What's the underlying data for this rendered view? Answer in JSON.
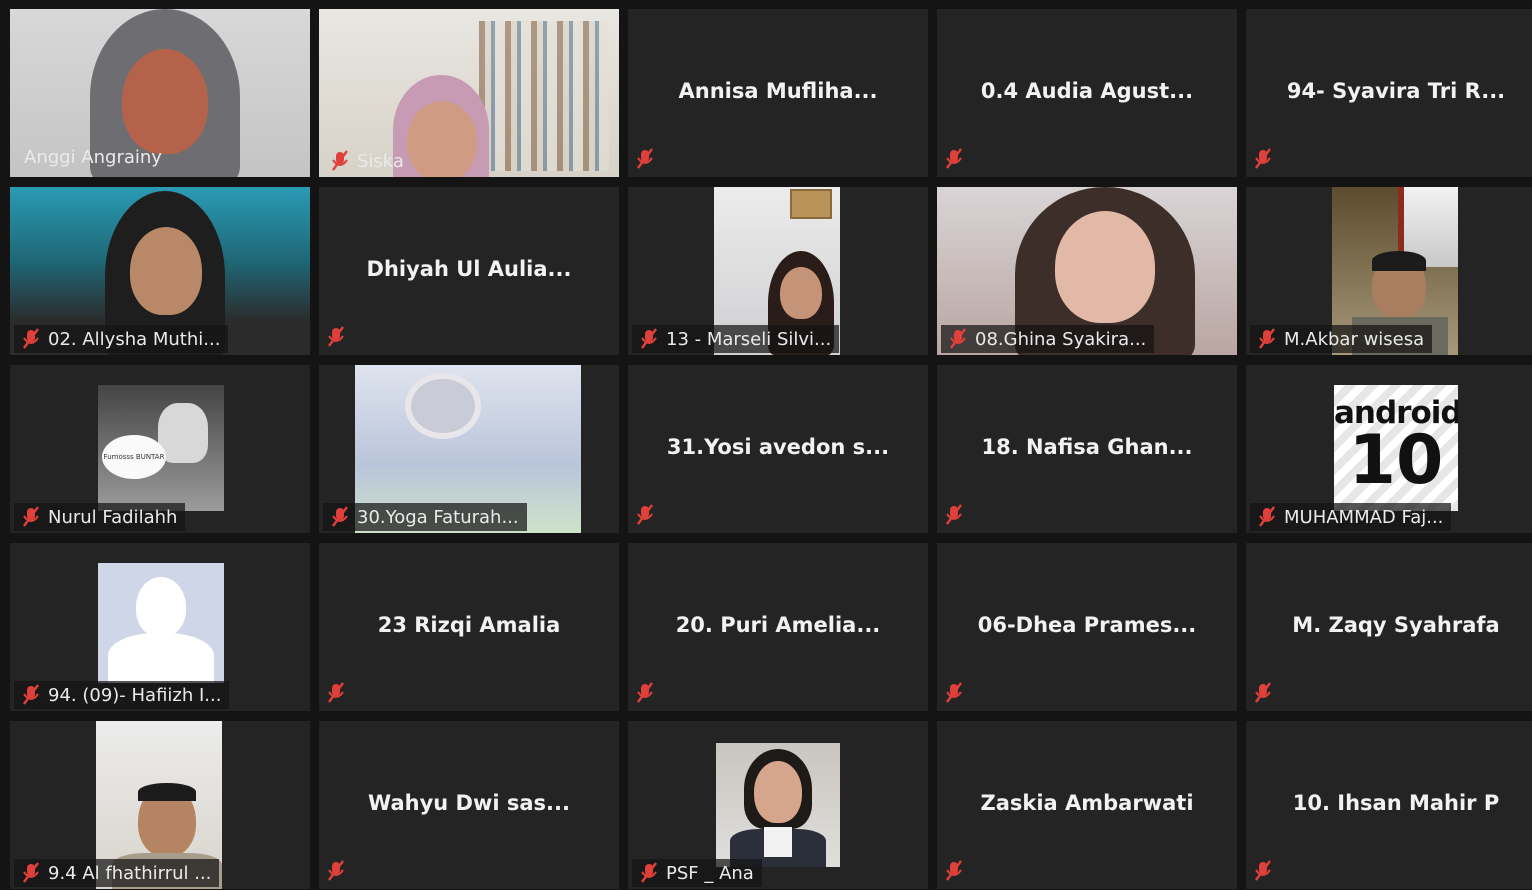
{
  "participants": [
    {
      "name": "Anggi Angrainy",
      "video": true,
      "active": true
    },
    {
      "name": "Siska",
      "video": true
    },
    {
      "name": "Annisa  Mufliha...",
      "video": false
    },
    {
      "name": "0.4 Audia Agust...",
      "video": false
    },
    {
      "name": "94- Syavira Tri R...",
      "video": false
    },
    {
      "name": "02. Allysha Muthi...",
      "video": true
    },
    {
      "name": "Dhiyah  Ul  Aulia...",
      "video": false
    },
    {
      "name": "13 - Marseli Silvi...",
      "video": true
    },
    {
      "name": "08.Ghina Syakira...",
      "video": true
    },
    {
      "name": "M.Akbar wisesa",
      "video": true
    },
    {
      "name": "Nurul Fadilahh",
      "video": true
    },
    {
      "name": "30.Yoga Faturah...",
      "video": true
    },
    {
      "name": "31.Yosi avedon s...",
      "video": false
    },
    {
      "name": "18. Nafisa Ghan...",
      "video": false
    },
    {
      "name": "MUHAMMAD Faj...",
      "video": true
    },
    {
      "name": "94. (09)- Hafiizh I...",
      "video": true
    },
    {
      "name": "23 Rizqi Amalia",
      "video": false
    },
    {
      "name": "20. Puri Amelia...",
      "video": false
    },
    {
      "name": "06-Dhea  Prames...",
      "video": false
    },
    {
      "name": "M. Zaqy Syahrafa",
      "video": false
    },
    {
      "name": "9.4 Al fhathirrul ...",
      "video": true
    },
    {
      "name": "Wahyu  Dwi  sas...",
      "video": false
    },
    {
      "name": "PSF _ Ana",
      "video": true
    },
    {
      "name": "Zaskia Ambarwati",
      "video": false
    },
    {
      "name": "10. Ihsan Mahir P",
      "video": false
    }
  ],
  "android_logo": {
    "line1": "android",
    "line2": "10"
  },
  "cat_sticker_text": "Fumosss BUNTAR",
  "colors": {
    "active_border": "#c4e45a",
    "mute_icon": "#e0403a",
    "tile_bg": "#242424",
    "gallery_bg": "#141414"
  },
  "icons": {
    "mute": "microphone-muted-icon"
  }
}
